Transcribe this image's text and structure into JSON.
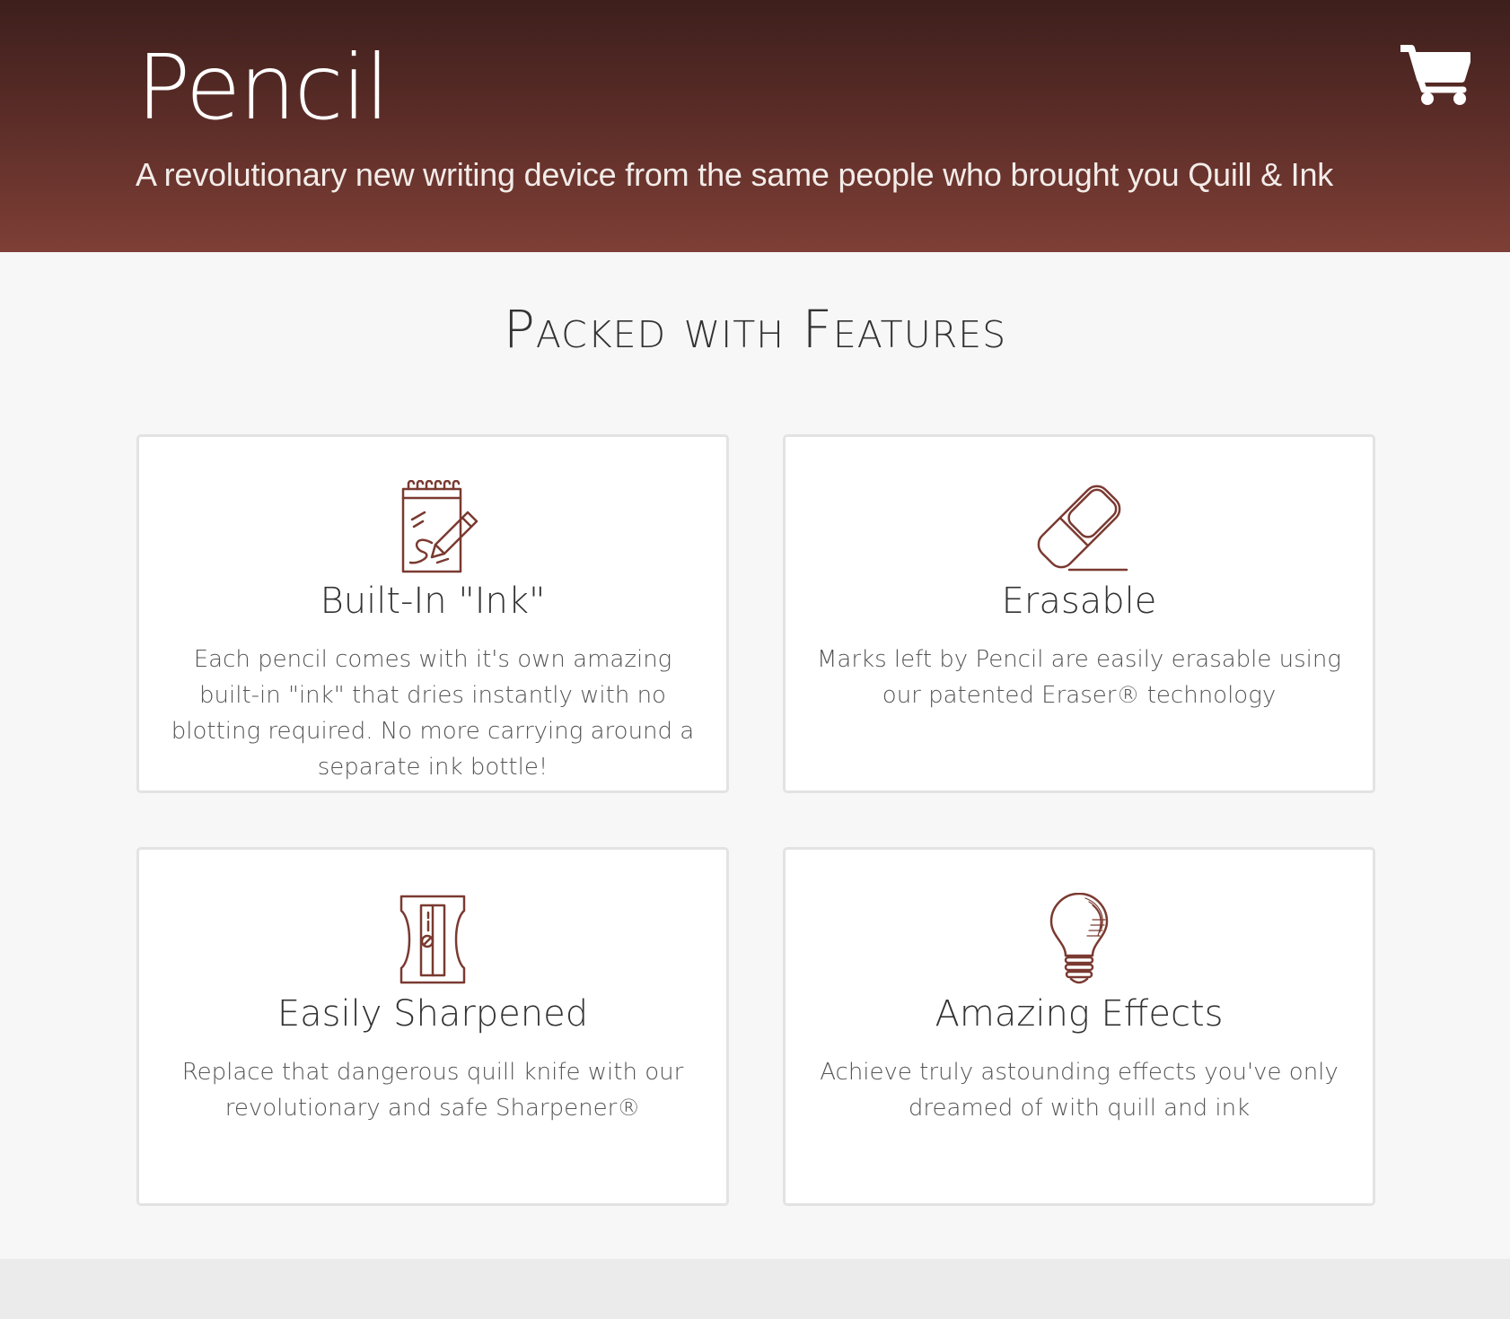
{
  "header": {
    "brand": "Pencil",
    "tagline": "A revolutionary new writing device from the same people who brought you Quill & Ink",
    "cart_icon": "shopping-cart-icon"
  },
  "features": {
    "heading": "Packed with Features",
    "cards": [
      {
        "icon": "notepad-pencil-icon",
        "title": "Built-In \"Ink\"",
        "text": "Each pencil comes with it's own amazing built-in \"ink\" that dries instantly with no blotting required. No more carrying around a separate ink bottle!"
      },
      {
        "icon": "eraser-icon",
        "title": "Erasable",
        "text": "Marks left by Pencil are easily erasable using our patented Eraser® technology"
      },
      {
        "icon": "sharpener-icon",
        "title": "Easily Sharpened",
        "text": "Replace that dangerous quill knife with our revolutionary and safe Sharpener®"
      },
      {
        "icon": "lightbulb-icon",
        "title": "Amazing Effects",
        "text": "Achieve truly astounding effects you've only dreamed of with quill and ink"
      }
    ]
  },
  "colors": {
    "header_top": "#3d1f1c",
    "header_bottom": "#7e3f36",
    "icon_stroke": "#7a3a31",
    "page_background": "#f7f7f7"
  }
}
